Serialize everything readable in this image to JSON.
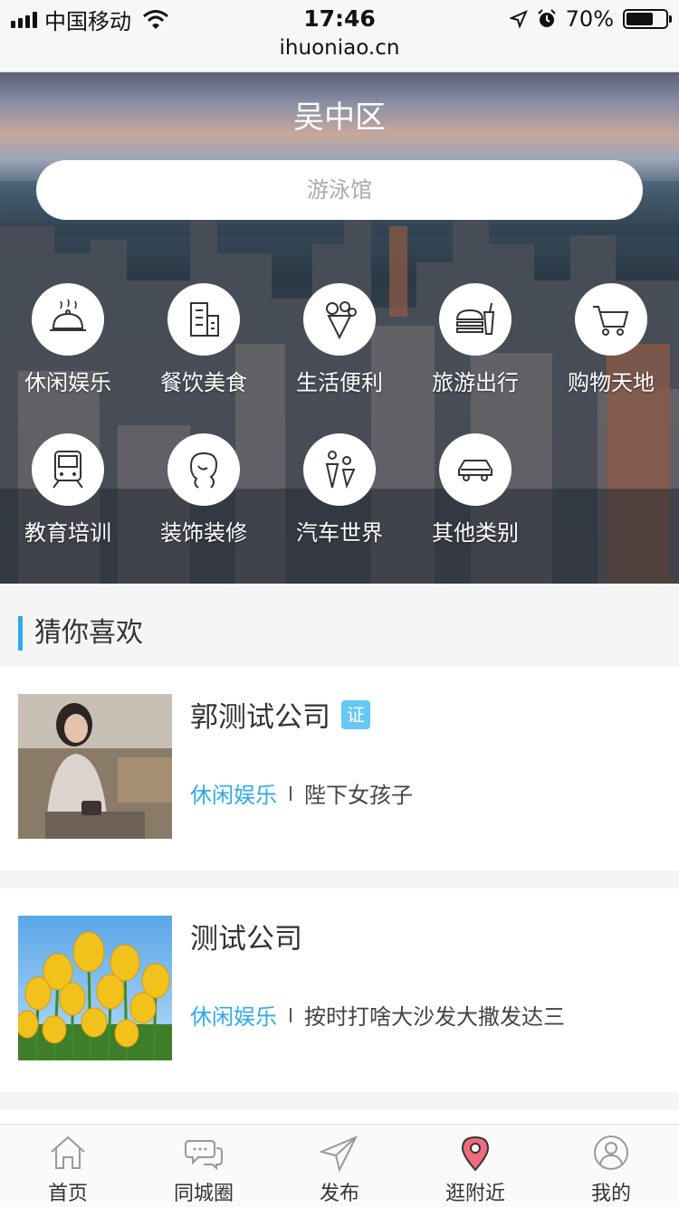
{
  "status_bar": {
    "carrier": "中国移动",
    "time": "17:46",
    "battery": "70%",
    "battery_level": 0.7,
    "url": "ihuoniao.cn"
  },
  "hero": {
    "title": "吴中区",
    "search_placeholder": "游泳馆"
  },
  "categories": [
    {
      "label": "休闲娱乐",
      "icon": "cloche-icon"
    },
    {
      "label": "餐饮美食",
      "icon": "building-icon"
    },
    {
      "label": "生活便利",
      "icon": "ice-cream-icon"
    },
    {
      "label": "旅游出行",
      "icon": "burger-drink-icon"
    },
    {
      "label": "购物天地",
      "icon": "cart-icon"
    },
    {
      "label": "教育培训",
      "icon": "train-icon"
    },
    {
      "label": "装饰装修",
      "icon": "hair-salon-icon"
    },
    {
      "label": "汽车世界",
      "icon": "people-icon"
    },
    {
      "label": "其他类别",
      "icon": "car-icon"
    }
  ],
  "section": {
    "title": "猜你喜欢"
  },
  "listings": [
    {
      "name": "郭测试公司",
      "badge": "证",
      "category": "休闲娱乐",
      "desc": "陛下女孩子"
    },
    {
      "name": "测试公司",
      "category": "休闲娱乐",
      "desc": "按时打啥大沙发大撒发达三"
    }
  ],
  "tabbar": [
    {
      "label": "首页",
      "icon": "home-icon"
    },
    {
      "label": "同城圈",
      "icon": "chat-icon"
    },
    {
      "label": "发布",
      "icon": "send-icon"
    },
    {
      "label": "逛附近",
      "icon": "location-pin-icon",
      "active": true
    },
    {
      "label": "我的",
      "icon": "profile-icon"
    }
  ],
  "colors": {
    "accent": "#2fa9ee",
    "badge": "#66c8f4",
    "pin": "#f06b7d"
  }
}
